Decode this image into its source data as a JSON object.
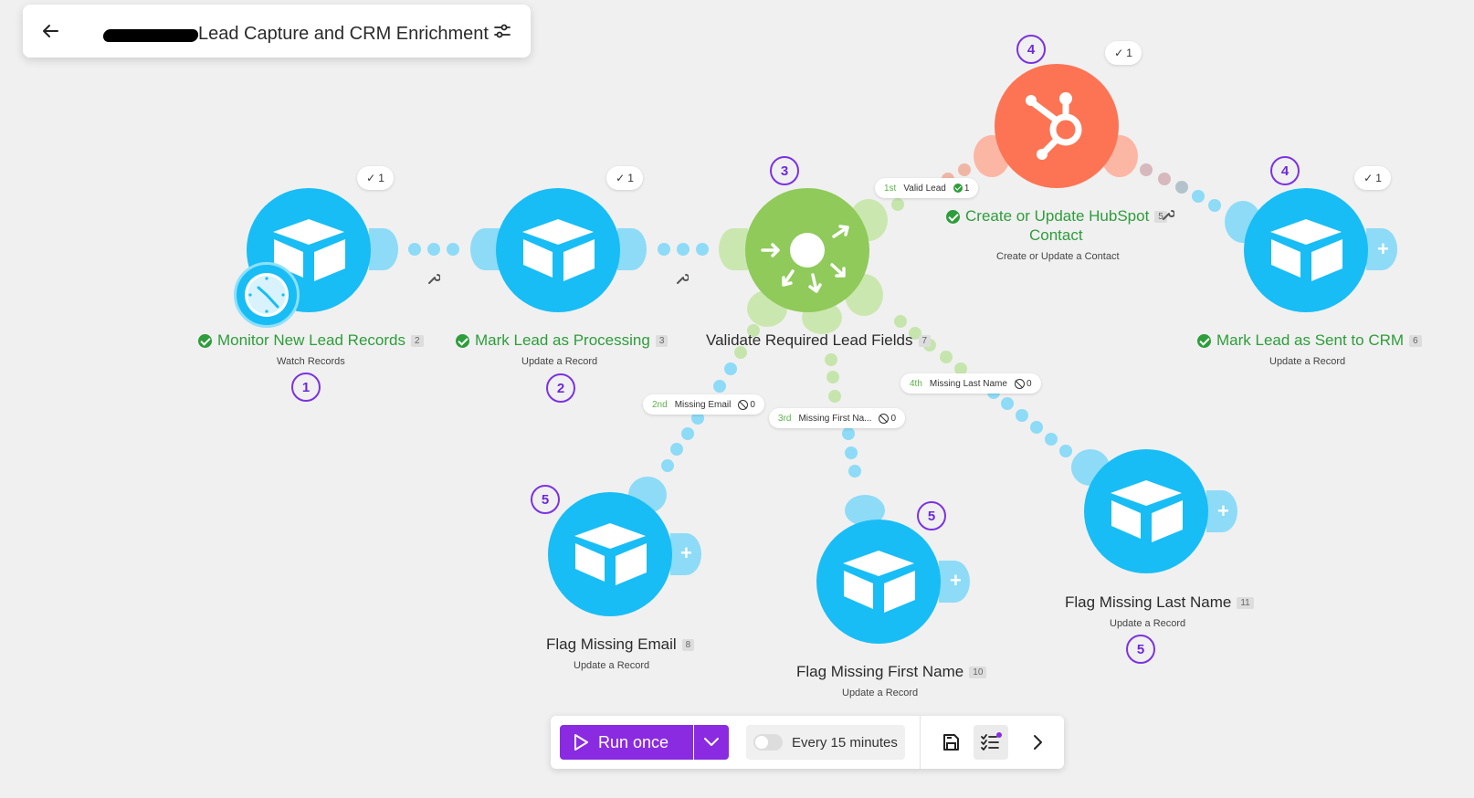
{
  "header": {
    "title": "Lead Capture and CRM Enrichment",
    "back_icon": "back-arrow-icon",
    "settings_icon": "sliders-icon"
  },
  "modules": {
    "monitor": {
      "title": "Monitor New Lead Records",
      "id": "2",
      "subtitle": "Watch Records",
      "executions": "1",
      "step": "1",
      "app": "airtable",
      "trigger": "clock-icon"
    },
    "mark_processing": {
      "title": "Mark Lead as Processing",
      "id": "3",
      "subtitle": "Update a Record",
      "executions": "1",
      "step": "2",
      "app": "airtable"
    },
    "router": {
      "title": "Validate Required Lead Fields",
      "id": "7",
      "step": "3",
      "app": "router"
    },
    "hubspot": {
      "title_line1": "Create or Update HubSpot",
      "title_line2": "Contact",
      "id": "5",
      "subtitle": "Create or Update a Contact",
      "executions": "1",
      "step": "4",
      "app": "hubspot"
    },
    "mark_sent": {
      "title": "Mark Lead as Sent to CRM",
      "id": "6",
      "subtitle": "Update a Record",
      "executions": "1",
      "step": "4",
      "app": "airtable"
    },
    "flag_email": {
      "title": "Flag Missing Email",
      "id": "8",
      "subtitle": "Update a Record",
      "step": "5",
      "app": "airtable"
    },
    "flag_first": {
      "title": "Flag Missing First Name",
      "id": "10",
      "subtitle": "Update a Record",
      "step": "5",
      "app": "airtable"
    },
    "flag_last": {
      "title": "Flag Missing Last Name",
      "id": "11",
      "subtitle": "Update a Record",
      "step": "5",
      "app": "airtable"
    }
  },
  "routes": [
    {
      "order": "1st",
      "name": "Valid Lead",
      "count": "1",
      "status": "ok"
    },
    {
      "order": "2nd",
      "name": "Missing Email",
      "count": "0",
      "status": "skipped"
    },
    {
      "order": "3rd",
      "name": "Missing First Na...",
      "count": "0",
      "status": "skipped"
    },
    {
      "order": "4th",
      "name": "Missing Last Name",
      "count": "0",
      "status": "skipped"
    }
  ],
  "toolbar": {
    "run_label": "Run once",
    "schedule_label": "Every 15 minutes",
    "schedule_enabled": false
  },
  "colors": {
    "airtable": "#18bdf5",
    "router": "#8fca5a",
    "hubspot": "#fd7454",
    "success": "#2e9d3b",
    "step_marker": "#7b32e2",
    "run_button": "#8a2be2"
  }
}
